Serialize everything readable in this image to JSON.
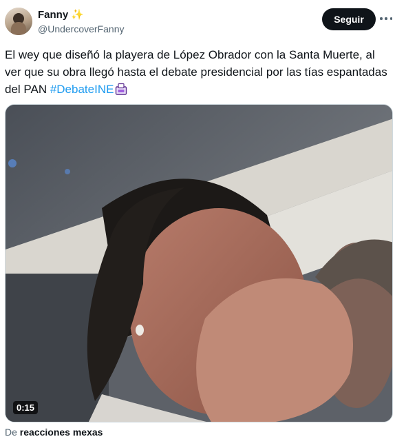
{
  "tweet": {
    "author": {
      "display_name": "Fanny",
      "badge_emoji": "✨",
      "handle": "@UndercoverFanny"
    },
    "follow_label": "Seguir",
    "more_icon": "more-horizontal-icon",
    "text_main": "El wey que diseñó la playera de López Obrador con la Santa Muerte, al ver que su obra llegó hasta el debate presidencial por las tías espantadas del PAN ",
    "hashtag": "#DebateINE",
    "hashtag_emoji": "ballot-box-icon",
    "media": {
      "type": "video",
      "duration": "0:15"
    },
    "attribution": {
      "prefix": "De",
      "source": "reacciones mexas"
    },
    "colors": {
      "hashtag": "#1d9bf0",
      "follow_bg": "#0f1419",
      "secondary_text": "#536471"
    }
  }
}
